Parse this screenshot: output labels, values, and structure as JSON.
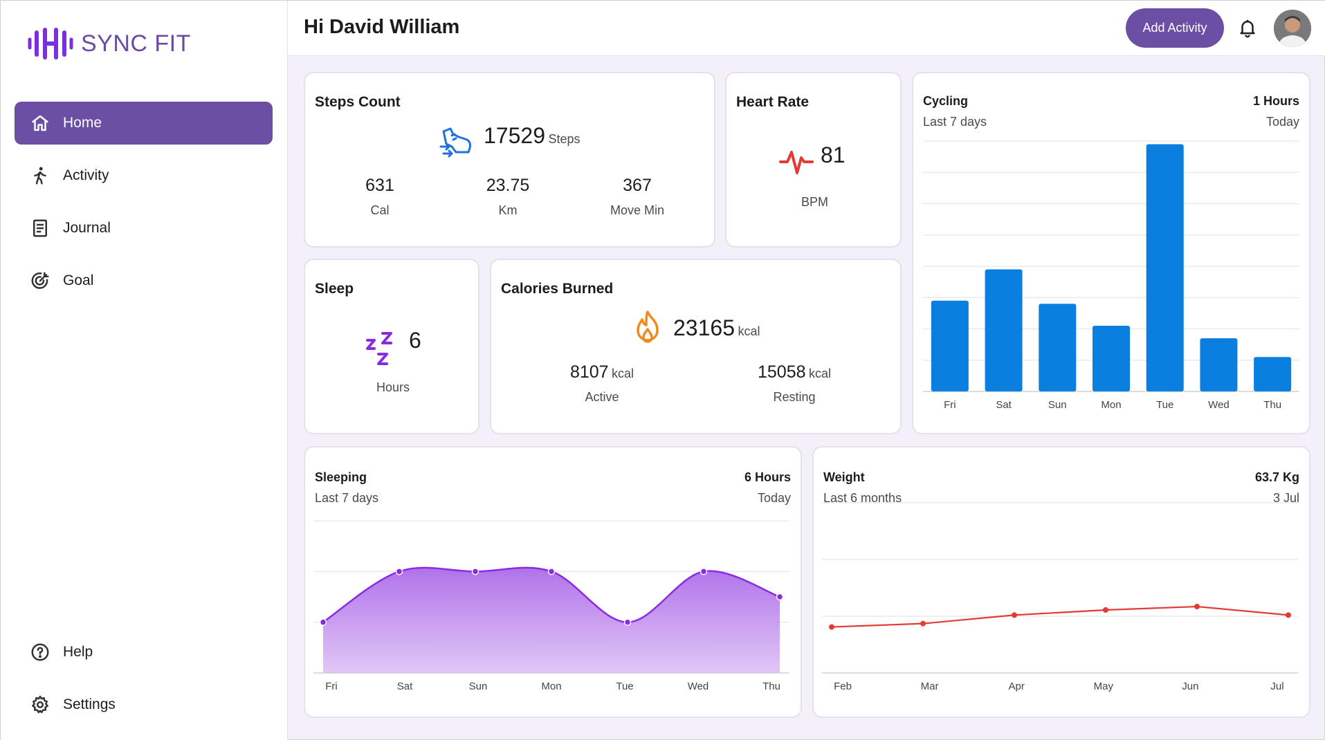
{
  "brand": {
    "name": "SYNC FIT",
    "color": "#6a4ba3"
  },
  "sidebar": {
    "items": [
      {
        "label": "Home",
        "icon": "home-icon",
        "active": true
      },
      {
        "label": "Activity",
        "icon": "walk-icon"
      },
      {
        "label": "Journal",
        "icon": "journal-icon"
      },
      {
        "label": "Goal",
        "icon": "goal-icon"
      }
    ],
    "bottom": [
      {
        "label": "Help",
        "icon": "help-icon"
      },
      {
        "label": "Settings",
        "icon": "gear-icon"
      }
    ]
  },
  "header": {
    "greeting": "Hi David William",
    "add_activity": "Add Activity"
  },
  "steps": {
    "title": "Steps Count",
    "value": "17529",
    "unit": "Steps",
    "stats": [
      {
        "value": "631",
        "label": "Cal"
      },
      {
        "value": "23.75",
        "label": "Km"
      },
      {
        "value": "367",
        "label": "Move Min"
      }
    ]
  },
  "heart": {
    "title": "Heart Rate",
    "value": "81",
    "unit": "BPM"
  },
  "sleep": {
    "title": "Sleep",
    "value": "6",
    "unit": "Hours"
  },
  "calories": {
    "title": "Calories Burned",
    "value": "23165",
    "unit": "kcal",
    "active": {
      "value": "8107",
      "unit": "kcal",
      "label": "Active"
    },
    "resting": {
      "value": "15058",
      "unit": "kcal",
      "label": "Resting"
    }
  },
  "cycling": {
    "title": "Cycling",
    "period": "Last 7 days",
    "total": "1 Hours",
    "when": "Today"
  },
  "sleeping": {
    "title": "Sleeping",
    "period": "Last 7 days",
    "total": "6 Hours",
    "when": "Today"
  },
  "weight": {
    "title": "Weight",
    "period": "Last 6 months",
    "total": "63.7 Kg",
    "when": "3 Jul"
  },
  "chart_data": [
    {
      "id": "cycling",
      "type": "bar",
      "categories": [
        "Fri",
        "Sat",
        "Sun",
        "Mon",
        "Tue",
        "Wed",
        "Thu"
      ],
      "values": [
        29,
        39,
        28,
        21,
        79,
        17,
        11
      ],
      "ylim": [
        0,
        80
      ],
      "color": "#0a7fe0",
      "grid": true
    },
    {
      "id": "sleeping",
      "type": "area",
      "categories": [
        "Fri",
        "Sat",
        "Sun",
        "Mon",
        "Tue",
        "Wed",
        "Thu"
      ],
      "values": [
        5,
        7,
        7,
        7,
        5,
        7,
        6
      ],
      "ylim": [
        3,
        9
      ],
      "color": "#8a2be2",
      "grid": true
    },
    {
      "id": "weight",
      "type": "line",
      "categories": [
        "Feb",
        "Mar",
        "Apr",
        "May",
        "Jun",
        "Jul"
      ],
      "values": [
        62.7,
        62.9,
        63.4,
        63.7,
        63.9,
        63.4
      ],
      "ylim": [
        60,
        70
      ],
      "color": "#e53935",
      "grid": true
    }
  ]
}
